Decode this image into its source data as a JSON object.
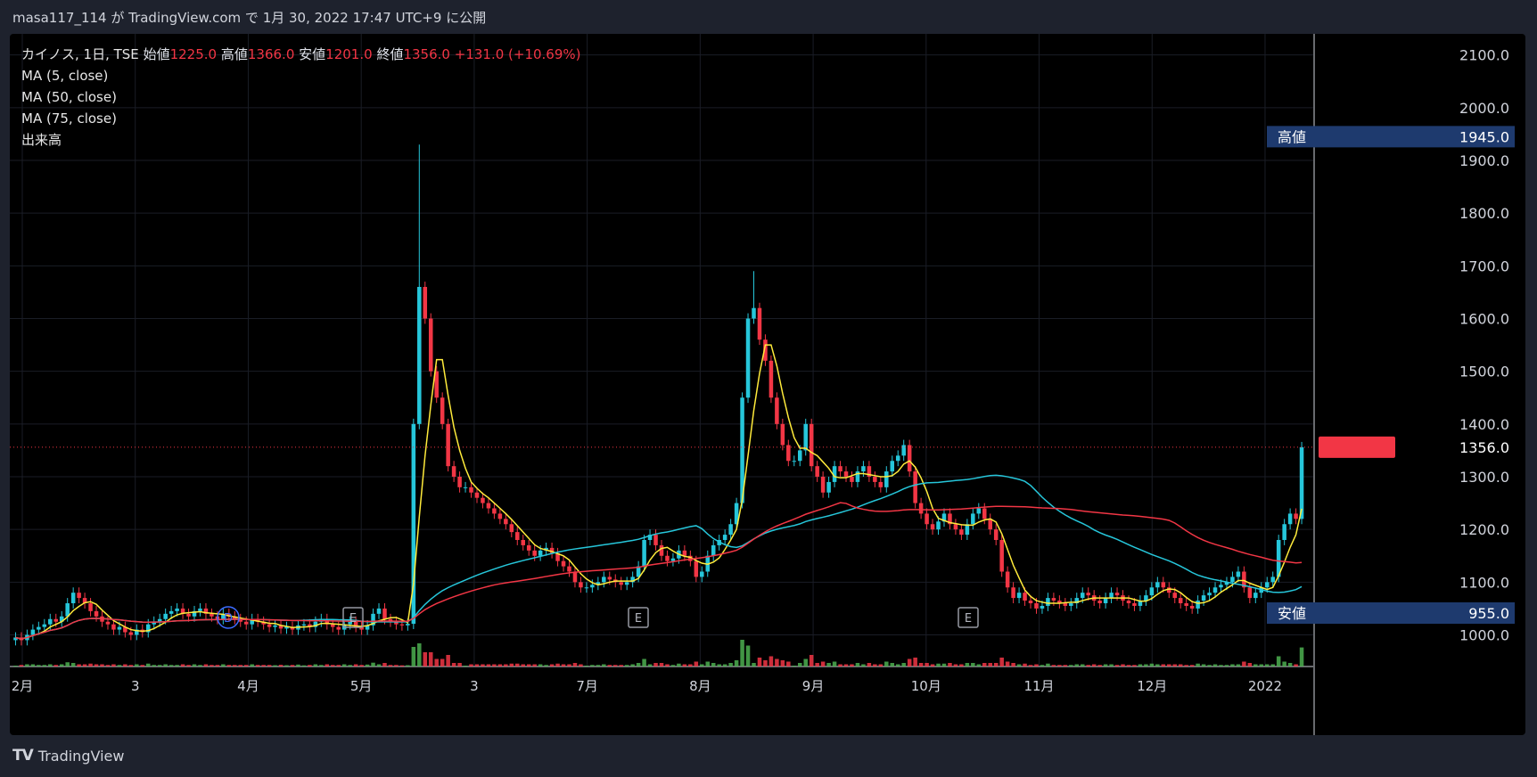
{
  "header": {
    "published_line": "masa117_114 が TradingView.com で 1月 30, 2022 17:47 UTC+9 に公開"
  },
  "legend": {
    "symbol": "カイノス, 1日, TSE",
    "open_label": "始値",
    "open_value": "1225.0",
    "high_label": "高値",
    "high_value": "1366.0",
    "low_label": "安値",
    "low_value": "1201.0",
    "close_label": "終値",
    "close_value": "1356.0",
    "change": "+131.0 (+10.69%)",
    "ma5": "MA (5, close)",
    "ma50": "MA (50, close)",
    "ma75": "MA (75, close)",
    "volume": "出来高"
  },
  "footer": {
    "brand": "TradingView"
  },
  "colors": {
    "up": "#26c6da",
    "down": "#f23645",
    "ma5": "#ffeb3b",
    "ma50": "#26c6da",
    "ma75": "#f23645",
    "price_line": "#f23645",
    "label_bg": "#1e3a6e",
    "vol_up": "#4caf50",
    "vol_down": "#f23645"
  },
  "chart_data": {
    "type": "candlestick",
    "y_range": [
      940,
      2140
    ],
    "y_ticks": [
      "2100.0",
      "2000.0",
      "1900.0",
      "1800.0",
      "1700.0",
      "1600.0",
      "1500.0",
      "1400.0",
      "1300.0",
      "1200.0",
      "1100.0",
      "1000.0"
    ],
    "x_ticks": [
      "2月",
      "3",
      "4月",
      "5月",
      "3",
      "7月",
      "8月",
      "9月",
      "10月",
      "11月",
      "12月",
      "2022"
    ],
    "markers": [
      "D",
      "E",
      "E",
      "E"
    ],
    "current_price": "1356.0",
    "high_label": "高値",
    "high_value": "1945.0",
    "low_label": "安値",
    "low_value": "955.0",
    "closes": [
      995,
      990,
      1000,
      1010,
      1015,
      1020,
      1030,
      1025,
      1035,
      1060,
      1080,
      1070,
      1060,
      1045,
      1035,
      1025,
      1020,
      1010,
      1015,
      1005,
      1000,
      1010,
      1005,
      1020,
      1025,
      1030,
      1040,
      1045,
      1050,
      1040,
      1035,
      1045,
      1050,
      1040,
      1035,
      1030,
      1040,
      1035,
      1030,
      1025,
      1020,
      1030,
      1025,
      1020,
      1015,
      1018,
      1012,
      1015,
      1010,
      1018,
      1020,
      1015,
      1025,
      1030,
      1020,
      1015,
      1010,
      1020,
      1025,
      1015,
      1010,
      1018,
      1040,
      1050,
      1030,
      1025,
      1020,
      1018,
      1021,
      1400,
      1660,
      1600,
      1500,
      1450,
      1400,
      1320,
      1300,
      1280,
      1280,
      1270,
      1260,
      1250,
      1240,
      1230,
      1220,
      1210,
      1195,
      1180,
      1170,
      1160,
      1150,
      1160,
      1165,
      1155,
      1140,
      1130,
      1120,
      1100,
      1090,
      1090,
      1095,
      1100,
      1110,
      1105,
      1100,
      1095,
      1100,
      1110,
      1130,
      1180,
      1190,
      1170,
      1150,
      1140,
      1145,
      1160,
      1150,
      1140,
      1110,
      1120,
      1150,
      1170,
      1180,
      1190,
      1210,
      1250,
      1450,
      1600,
      1620,
      1560,
      1520,
      1450,
      1400,
      1360,
      1330,
      1330,
      1350,
      1400,
      1320,
      1300,
      1270,
      1290,
      1320,
      1310,
      1300,
      1290,
      1310,
      1320,
      1300,
      1290,
      1280,
      1310,
      1330,
      1340,
      1360,
      1310,
      1250,
      1230,
      1210,
      1200,
      1215,
      1230,
      1210,
      1200,
      1190,
      1210,
      1230,
      1240,
      1220,
      1200,
      1180,
      1120,
      1090,
      1070,
      1080,
      1065,
      1060,
      1050,
      1055,
      1070,
      1065,
      1060,
      1055,
      1060,
      1070,
      1080,
      1075,
      1065,
      1060,
      1070,
      1080,
      1075,
      1065,
      1060,
      1055,
      1065,
      1075,
      1090,
      1100,
      1090,
      1080,
      1070,
      1060,
      1055,
      1050,
      1065,
      1075,
      1080,
      1090,
      1095,
      1100,
      1110,
      1120,
      1090,
      1070,
      1080,
      1090,
      1100,
      1110,
      1180,
      1210,
      1230,
      1220,
      1356
    ]
  }
}
